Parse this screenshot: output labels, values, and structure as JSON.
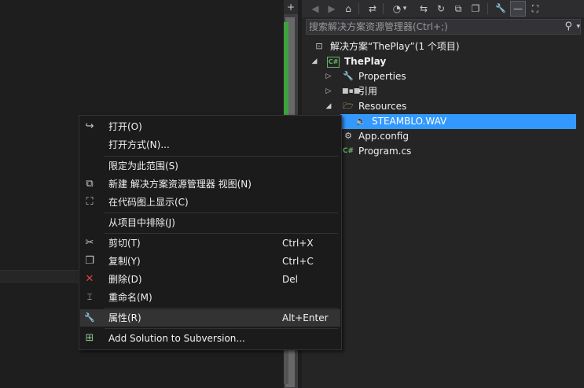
{
  "scrollbar": {
    "top_button": "+"
  },
  "toolbar": {
    "buttons": [
      {
        "name": "back-icon",
        "glyph": "◀",
        "dim": true
      },
      {
        "name": "forward-icon",
        "glyph": "▶",
        "dim": true
      },
      {
        "name": "home-icon",
        "glyph": "⌂"
      },
      {
        "name": "sync-with-document-icon",
        "glyph": "⇄"
      },
      {
        "name": "pending-changes-filter-icon",
        "glyph": "◔"
      },
      {
        "name": "dropdown-arrow-icon",
        "glyph": "▾"
      },
      {
        "name": "switch-views-icon",
        "glyph": "⇆"
      },
      {
        "name": "refresh-icon",
        "glyph": "↻"
      },
      {
        "name": "collapse-all-icon",
        "glyph": "⧉"
      },
      {
        "name": "show-all-files-icon",
        "glyph": "❐"
      },
      {
        "name": "properties-wrench-icon",
        "glyph": "🔧"
      },
      {
        "name": "preview-selected-icon",
        "glyph": "—"
      },
      {
        "name": "class-diagram-icon",
        "glyph": "⛶"
      }
    ]
  },
  "search": {
    "placeholder": "搜索解决方案资源管理器(Ctrl+;)",
    "search_icon": "⚲",
    "dropdown_icon": "▾"
  },
  "tree": {
    "solution": "解决方案“ThePlay”(1 个项目)",
    "project": "ThePlay",
    "properties": "Properties",
    "references": "引用",
    "resources": "Resources",
    "resource_file": "STEAMBLO.WAV",
    "app_config": "App.config",
    "program": "Program.cs",
    "cs_badge": "C#"
  },
  "context_menu": {
    "open": "打开(O)",
    "open_with": "打开方式(N)...",
    "scope_to_this": "限定为此范围(S)",
    "new_view": "新建 解决方案资源管理器 视图(N)",
    "show_on_code_map": "在代码图上显示(C)",
    "exclude_from_project": "从项目中排除(J)",
    "cut": "剪切(T)",
    "cut_shortcut": "Ctrl+X",
    "copy": "复制(Y)",
    "copy_shortcut": "Ctrl+C",
    "delete": "删除(D)",
    "delete_shortcut": "Del",
    "rename": "重命名(M)",
    "properties": "属性(R)",
    "properties_shortcut": "Alt+Enter",
    "add_to_svn": "Add Solution to Subversion..."
  },
  "colors": {
    "selection": "#3399ff",
    "delete_icon": "#e04343",
    "cs_green": "#68b168",
    "folder": "#dcb67a"
  }
}
